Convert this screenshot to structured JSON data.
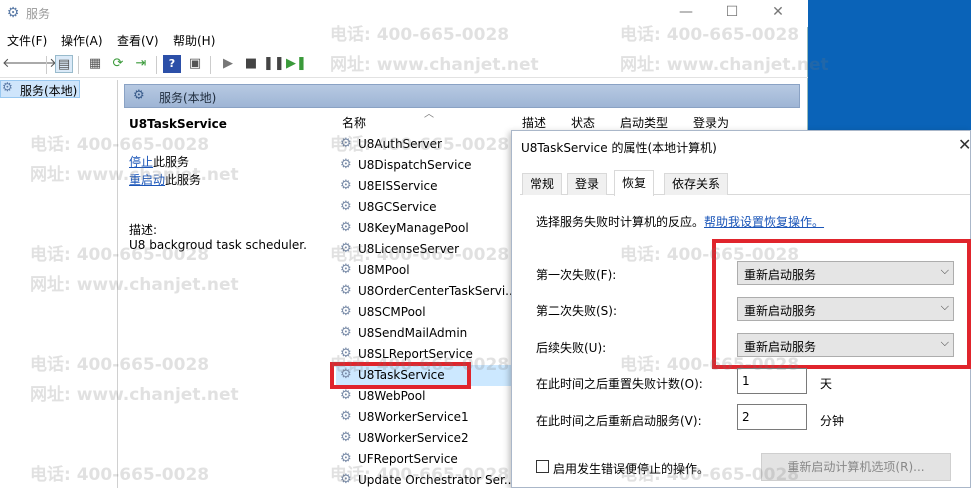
{
  "window": {
    "title": "服务",
    "controls": {
      "minimize": "—",
      "maximize": "☐",
      "close": "✕"
    }
  },
  "menubar": [
    "文件(F)",
    "操作(A)",
    "查看(V)",
    "帮助(H)"
  ],
  "toolbar": {
    "icons": [
      "back-icon",
      "forward-icon",
      "show-tree-icon",
      "properties-icon",
      "refresh-icon",
      "export-icon",
      "help-icon",
      "console-icon",
      "start-icon",
      "stop-icon",
      "pause-icon",
      "resume-icon"
    ]
  },
  "tree": {
    "root": "服务(本地)"
  },
  "band": {
    "title": "服务(本地)"
  },
  "detail": {
    "service_name": "U8TaskService",
    "stop_link": "停止",
    "stop_suffix": "此服务",
    "restart_link": "重启动",
    "restart_suffix": "此服务",
    "desc_label": "描述:",
    "desc_text": "U8 backgroud task scheduler."
  },
  "list": {
    "columns": [
      "名称",
      "描述",
      "状态",
      "启动类型",
      "登录为"
    ],
    "services": [
      "U8AuthServer",
      "U8DispatchService",
      "U8EISService",
      "U8GCService",
      "U8KeyManagePool",
      "U8LicenseServer",
      "U8MPool",
      "U8OrderCenterTaskServi...",
      "U8SCMPool",
      "U8SendMailAdmin",
      "U8SLReportService",
      "U8TaskService",
      "U8WebPool",
      "U8WorkerService1",
      "U8WorkerService2",
      "UFReportService",
      "Update Orchestrator Ser..."
    ],
    "selected": "U8TaskService"
  },
  "dialog": {
    "title": "U8TaskService 的属性(本地计算机)",
    "close": "✕",
    "tabs": [
      "常规",
      "登录",
      "恢复",
      "依存关系"
    ],
    "active_tab": "恢复",
    "intro": "选择服务失败时计算机的反应。",
    "help_link": "帮助我设置恢复操作。",
    "first_label": "第一次失败(F):",
    "second_label": "第二次失败(S):",
    "subsequent_label": "后续失败(U):",
    "first_value": "重新启动服务",
    "second_value": "重新启动服务",
    "subsequent_value": "重新启动服务",
    "reset_label": "在此时间之后重置失败计数(O):",
    "reset_value": "1",
    "reset_unit": "天",
    "restart_label": "在此时间之后重新启动服务(V):",
    "restart_value": "2",
    "restart_unit": "分钟",
    "checkbox_label": "启用发生错误便停止的操作。",
    "restart_computer_button": "重新启动计算机选项(R)..."
  },
  "watermark": {
    "phone": "电话: 400-665-0028",
    "site": "网址: www.chanjet.net"
  },
  "colors": {
    "highlight": "#e0242c",
    "selection": "#cce8ff",
    "desktop": "#0a63b8"
  }
}
